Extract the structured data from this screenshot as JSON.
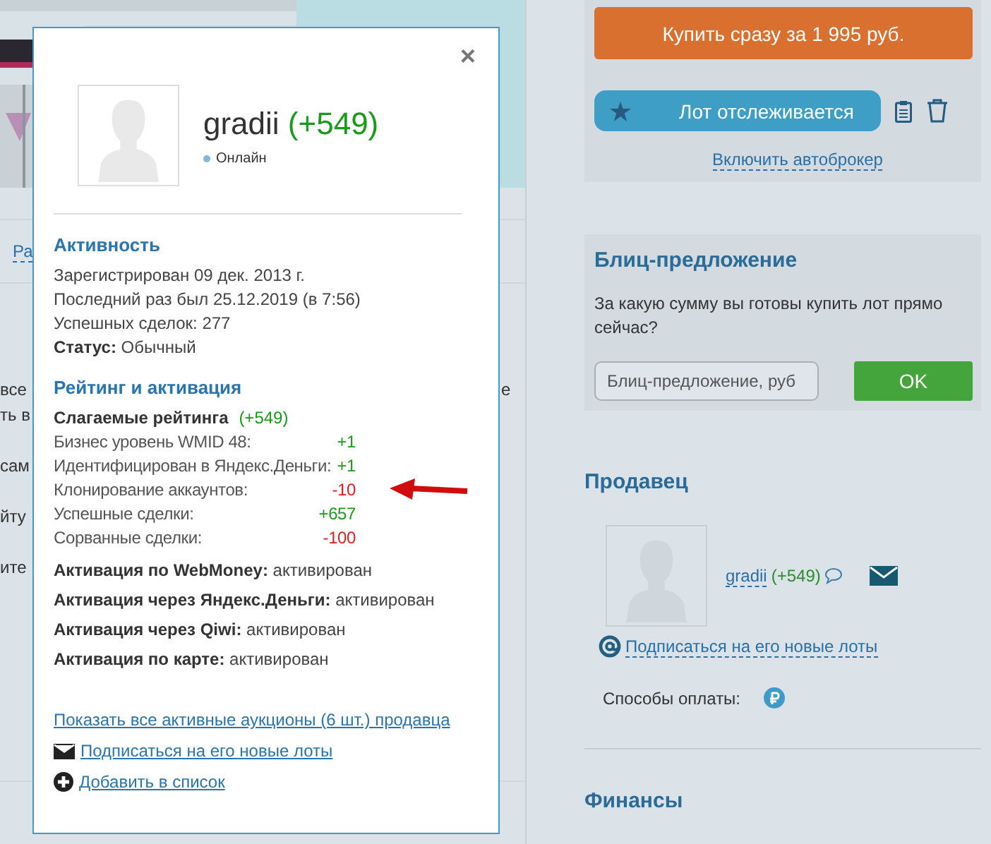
{
  "background": {
    "tab_link": "Ра",
    "fragments": [
      "все",
      "ть в",
      "сам",
      "йту",
      "ите"
    ],
    "right_fragment": "е"
  },
  "popup": {
    "close": "×",
    "name": "gradii",
    "rating": "(+549)",
    "status": "Онлайн",
    "activity": {
      "title": "Активность",
      "lines": [
        "Зарегистрирован 09 дек. 2013 г.",
        "Последний раз был 25.12.2019 (в 7:56)",
        "Успешных сделок: 277",
        "**Статус:** Обычный"
      ]
    },
    "rating_section": {
      "title": "Рейтинг и активация",
      "summary_label": "Слагаемые рейтинга",
      "summary_value": "(+549)",
      "items": [
        {
          "label": "Бизнес уровень WMID 48:",
          "value": "+1",
          "color": "#1f9a1f"
        },
        {
          "label": "Идентифицирован в Яндекс.Деньги:",
          "value": "+1",
          "color": "#1f9a1f"
        },
        {
          "label": "Клонирование аккаунтов:",
          "value": "-10",
          "color": "#e02020"
        },
        {
          "label": "Успешные сделки:",
          "value": "+657",
          "color": "#1f9a1f"
        },
        {
          "label": "Сорванные сделки:",
          "value": "-100",
          "color": "#e02020"
        }
      ],
      "activations": [
        {
          "label": "Активация по WebMoney:",
          "value": "активирован"
        },
        {
          "label": "Активация через Яндекс.Деньги:",
          "value": "активирован"
        },
        {
          "label": "Активация через Qiwi:",
          "value": "активирован"
        },
        {
          "label": "Активация по карте:",
          "value": "активирован"
        }
      ]
    },
    "all_auctions_link": "Показать все активные аукционы (6 шт.) продавца",
    "actions": [
      {
        "kind": "subscribe",
        "label": "Подписаться на его новые лоты"
      },
      {
        "kind": "add",
        "label": "Добавить в список"
      }
    ]
  },
  "buy": {
    "buy_now": "Купить сразу за 1 995 руб.",
    "watch": "Лот отслеживается",
    "autobroker": "Включить автоброкер"
  },
  "blitz": {
    "title": "Блиц-предложение",
    "question": "За какую сумму вы готовы купить лот прямо сейчас?",
    "placeholder": "Блиц-предложение, руб",
    "ok": "OK"
  },
  "seller": {
    "title": "Продавец",
    "name": "gradii",
    "rating": "(+549)",
    "subscribe": "Подписаться на его новые лоты",
    "payment_label": "Способы оплаты:"
  },
  "finance": {
    "title": "Финансы"
  }
}
